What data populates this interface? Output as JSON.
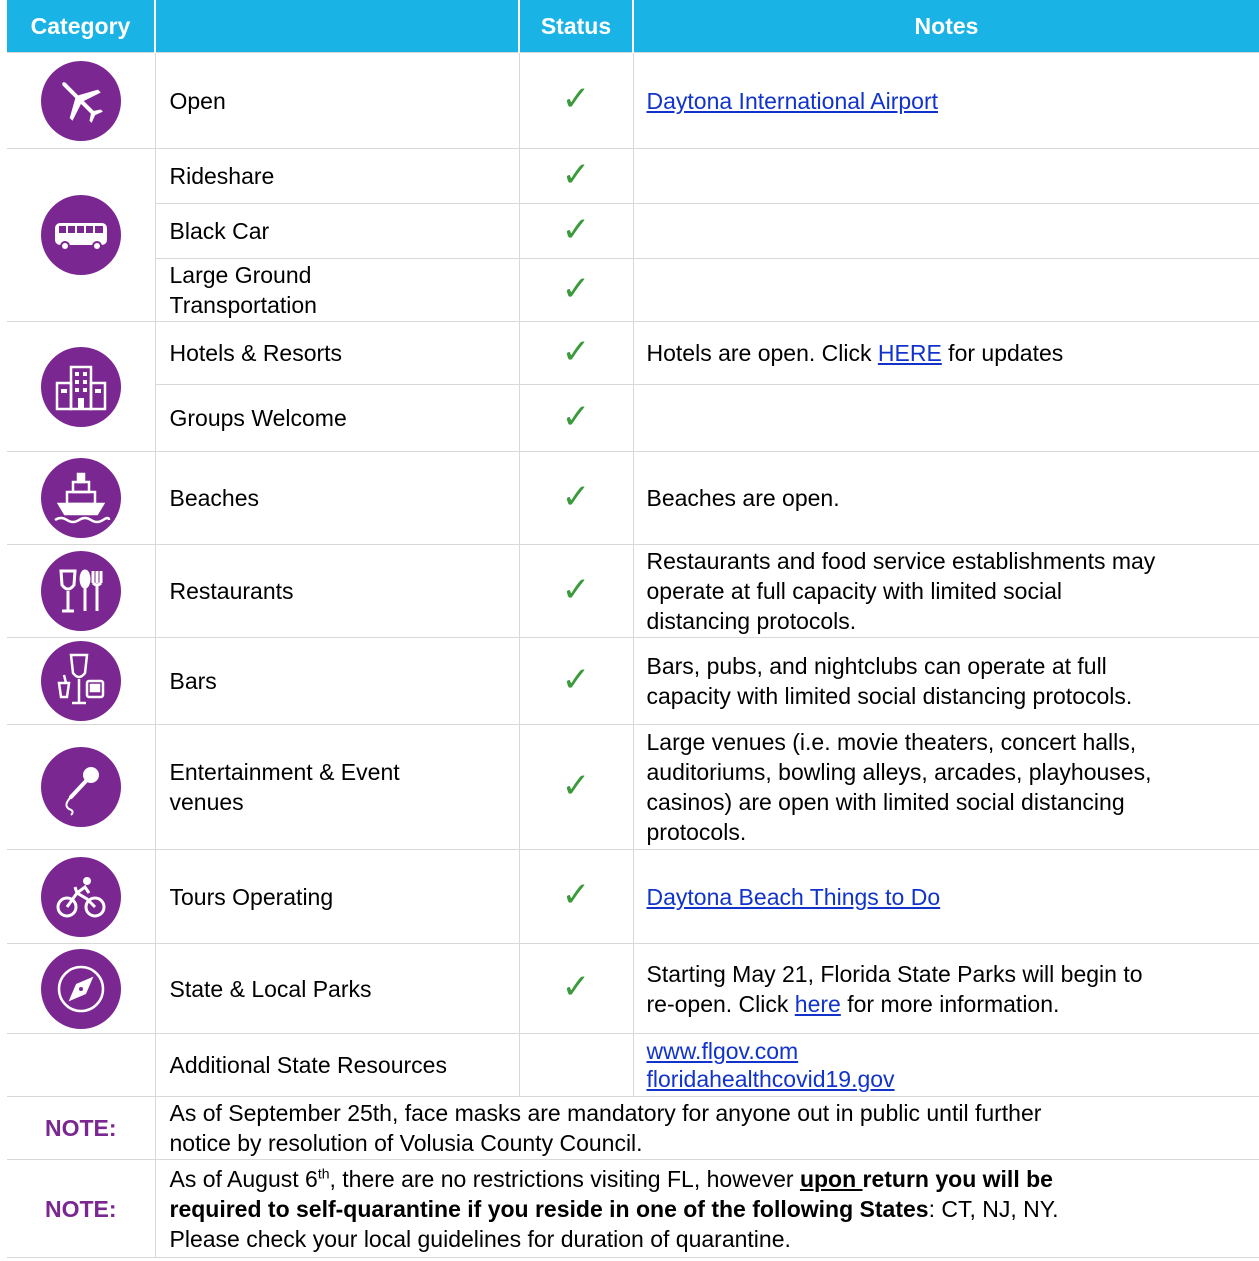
{
  "header": {
    "category": "Category",
    "status": "Status",
    "notes": "Notes"
  },
  "check_glyph": "✓",
  "accent_color": "#7b2791",
  "header_color": "#1ab3e6",
  "rows": {
    "air": {
      "icon": "airplane-icon",
      "label": "Open",
      "link": "Daytona International Airport"
    },
    "rideshare": {
      "label": "Rideshare"
    },
    "black_car": {
      "label": "Black Car"
    },
    "large_ground": {
      "icon": "bus-icon",
      "label_line1": "Large Ground",
      "label_line2": "Transportation"
    },
    "hotels": {
      "icon": "hotel-icon",
      "label": "Hotels & Resorts",
      "note_pre": "Hotels are open.  Click ",
      "note_link": "HERE",
      "note_post": " for updates"
    },
    "groups": {
      "label": "Groups Welcome"
    },
    "beaches": {
      "icon": "ship-icon",
      "label": "Beaches",
      "note": "Beaches are open."
    },
    "restaurants": {
      "icon": "dining-icon",
      "label": "Restaurants",
      "note_l1": "Restaurants and food service establishments may",
      "note_l2": "operate at full capacity with limited social",
      "note_l3": "distancing protocols."
    },
    "bars": {
      "icon": "drinks-icon",
      "label": "Bars",
      "note_l1": "Bars, pubs, and nightclubs can operate at full",
      "note_l2": "capacity with limited social distancing protocols."
    },
    "entertainment": {
      "icon": "microphone-icon",
      "label_line1": "Entertainment & Event",
      "label_line2": "venues",
      "note_l1": "Large venues (i.e. movie theaters, concert halls,",
      "note_l2": "auditoriums, bowling alleys, arcades, playhouses,",
      "note_l3": "casinos) are open with limited social distancing",
      "note_l4": "protocols."
    },
    "tours": {
      "icon": "bicycle-icon",
      "label": "Tours Operating",
      "link": "Daytona Beach Things to Do"
    },
    "parks": {
      "icon": "compass-icon",
      "label": "State & Local Parks",
      "note_l1": "Starting May 21, Florida State Parks will begin to",
      "note_pre": "re-open.  Click ",
      "note_link": "here",
      "note_post": " for more information."
    },
    "resources": {
      "label": "Additional State Resources",
      "link1": "www.flgov.com",
      "link2": "floridahealthcovid19.gov"
    }
  },
  "notes_footer": {
    "note1": {
      "label": "NOTE:",
      "line1": "As of September 25th, face masks are mandatory for anyone out in public until further",
      "line2": "notice by resolution of Volusia County Council."
    },
    "note2": {
      "label": "NOTE:",
      "pre": "As of August 6",
      "sup": "th",
      "mid": ", there are no restrictions visiting FL, however ",
      "bold_u": "upon ",
      "bold1": "return you will be",
      "bold2": "required to self-quarantine if you reside in one of the following States",
      "post": ": CT, NJ, NY.",
      "line3": "Please check your local guidelines for duration of quarantine."
    }
  }
}
